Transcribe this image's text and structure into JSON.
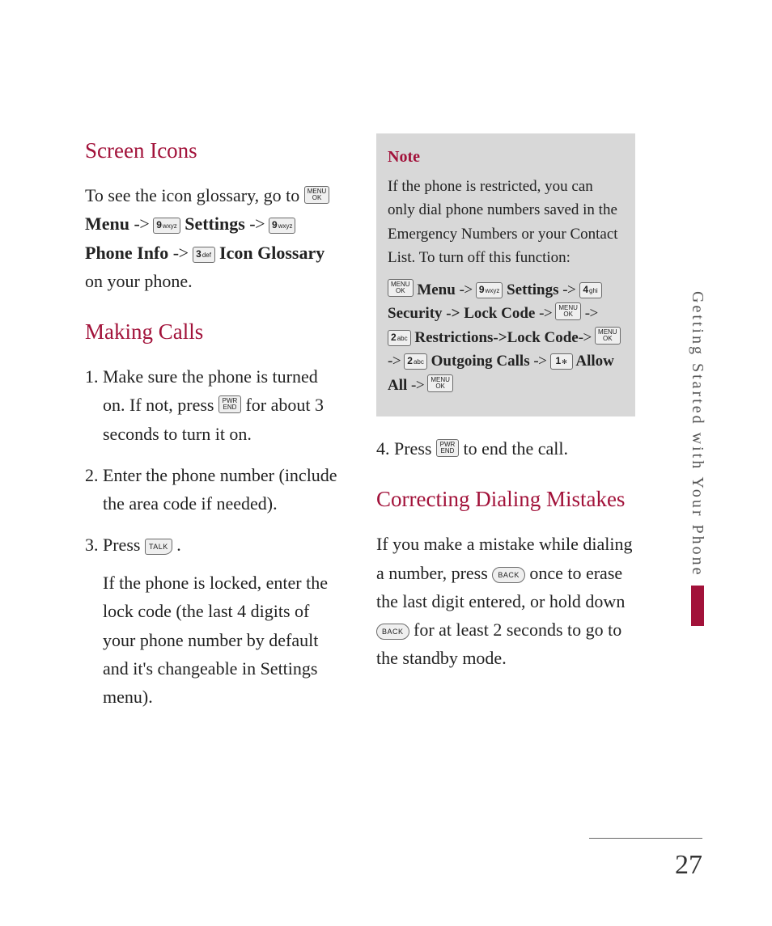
{
  "side_tab": "Getting Started with Your Phone",
  "page_number": "27",
  "keys": {
    "menu_ok_top": "MENU",
    "menu_ok_bottom": "OK",
    "end_top": "PWR",
    "end_bottom": "END",
    "talk": "TALK",
    "back": "BACK",
    "k9_d": "9",
    "k9_l": "wxyz",
    "k3_d": "3",
    "k3_l": "def",
    "k4_d": "4",
    "k4_l": "ghi",
    "k2_d": "2",
    "k2_l": "abc",
    "k1_d": "1",
    "k1_l": "✻"
  },
  "arrow": " -> ",
  "h_screen_icons": "Screen Icons",
  "p_icon_glossary_a": "To see the icon glossary, go to ",
  "seq_icon": {
    "menu": " Menu",
    "settings": " Settings",
    "phone_info": " Phone Info",
    "icon_glossary": " Icon Glossary"
  },
  "p_icon_glossary_b": " on your phone.",
  "h_making_calls": "Making Calls",
  "li1_a": "Make sure the phone is turned on. If not, press ",
  "li1_b": " for about 3 seconds to turn it on.",
  "li2": "Enter the phone number (include the area code if needed).",
  "li3_a": "Press ",
  "li3_b": " .",
  "p_locked": "If the phone is locked, enter the lock code (the last 4 digits of your phone number by default and it's changeable in Settings menu).",
  "note_title": "Note",
  "note_body": "If the phone is restricted, you can only dial phone numbers saved in the Emergency Numbers or your Contact List. To turn off this function:",
  "note_seq": {
    "menu": " Menu",
    "settings": " Settings",
    "security": " Security -> Lock Code",
    "restrictions": " Restrictions->Lock Code",
    "outgoing": " Outgoing Calls",
    "allow_all": " Allow All"
  },
  "li4_a": "4. Press ",
  "li4_b": " to end the call.",
  "h_correcting": "Correcting Dialing Mistakes",
  "p_correct_a": "If you make a mistake while dialing a number, press ",
  "p_correct_b": " once to erase the last digit entered, or hold down ",
  "p_correct_c": " for at least 2 seconds to go to the standby mode."
}
